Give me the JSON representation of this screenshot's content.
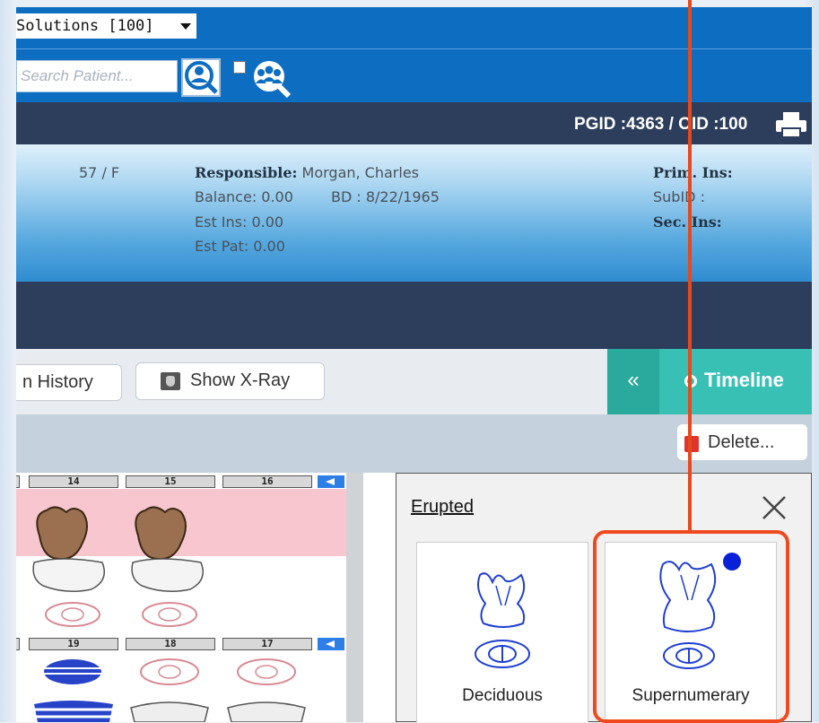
{
  "header": {
    "practice_select": "Solutions [100]",
    "search_placeholder": "Search Patient...",
    "pgid_label": "PGID :4363",
    "separator": "/",
    "oid_label": "OID :100"
  },
  "patient": {
    "age_sex": "57 / F",
    "responsible_label": "Responsible:",
    "responsible_name": "Morgan, Charles",
    "balance": "Balance: 0.00",
    "birth_date": "BD : 8/22/1965",
    "est_ins": "Est Ins:  0.00",
    "est_pat": "Est Pat: 0.00",
    "prim_ins_label": "Prim. Ins:",
    "subid_label": "SubID :",
    "sec_ins_label": "Sec. Ins:"
  },
  "toolbar": {
    "history_label": "n History",
    "xray_label": "Show X-Ray",
    "collapse_label": "«",
    "timeline_label": "Timeline",
    "delete_label": "Delete..."
  },
  "tooth_chart": {
    "upper_numbers": [
      "14",
      "15",
      "16"
    ],
    "lower_numbers": [
      "19",
      "18",
      "17"
    ]
  },
  "erupted_panel": {
    "title": "Erupted",
    "close_label": "✕",
    "options": [
      {
        "label": "Deciduous"
      },
      {
        "label": "Supernumerary",
        "selected": true
      }
    ]
  },
  "colors": {
    "topbar": "#0d6dc0",
    "darkbar": "#2c3e5c",
    "timeline": "#39c0b5",
    "annotation": "#e44a21",
    "outline_blue": "#1f3fd0"
  }
}
